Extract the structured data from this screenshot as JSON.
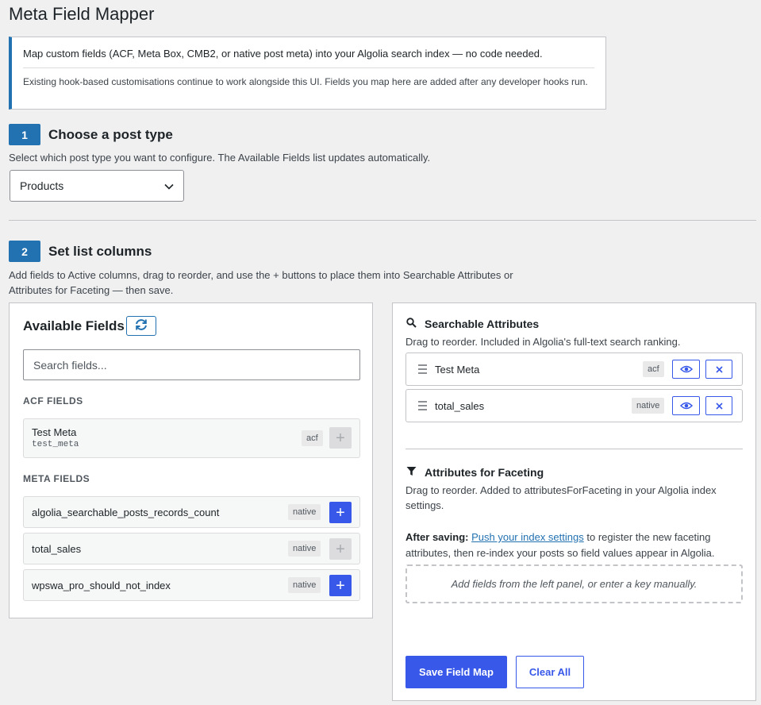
{
  "page": {
    "title": "Meta Field Mapper"
  },
  "notice": {
    "line1": "Map custom fields (ACF, Meta Box, CMB2, or native post meta) into your Algolia search index — no code needed.",
    "line2": "Existing hook-based customisations continue to work alongside this UI. Fields you map here are added after any developer hooks run."
  },
  "step1": {
    "number": "1",
    "title": "Choose a post type",
    "description": "Select which post type you want to configure. The Available Fields list updates automatically.",
    "selected_post_type": "Products"
  },
  "step2": {
    "number": "2",
    "title": "Set list columns",
    "description": "Add fields to Active columns, drag to reorder, and use the + buttons to place them into Searchable Attributes or Attributes for Faceting — then save."
  },
  "available": {
    "title": "Available Fields",
    "search_placeholder": "Search fields...",
    "acf_label": "ACF FIELDS",
    "meta_label": "META FIELDS",
    "acf_fields": [
      {
        "name": "Test Meta",
        "key": "test_meta",
        "source": "acf",
        "added": true
      }
    ],
    "meta_fields": [
      {
        "name": "algolia_searchable_posts_records_count",
        "source": "native",
        "added": false
      },
      {
        "name": "total_sales",
        "source": "native",
        "added": true
      },
      {
        "name": "wpswa_pro_should_not_index",
        "source": "native",
        "added": false
      }
    ]
  },
  "searchable": {
    "title": "Searchable Attributes",
    "description": "Drag to reorder. Included in Algolia's full-text search ranking.",
    "items": [
      {
        "name": "Test Meta",
        "source": "acf"
      },
      {
        "name": "total_sales",
        "source": "native"
      }
    ]
  },
  "faceting": {
    "title": "Attributes for Faceting",
    "description": "Drag to reorder. Added to attributesForFaceting in your Algolia index settings.",
    "after_saving_label": "After saving:",
    "push_link": "Push your index settings",
    "after_saving_text": "to register the new faceting attributes, then re-index your posts so field values appear in Algolia.",
    "empty_text": "Add fields from the left panel, or enter a key manually."
  },
  "actions": {
    "save": "Save Field Map",
    "clear": "Clear All"
  },
  "colors": {
    "accent": "#3858e9",
    "step_badge": "#2271b1",
    "notice_border": "#2271b1"
  }
}
